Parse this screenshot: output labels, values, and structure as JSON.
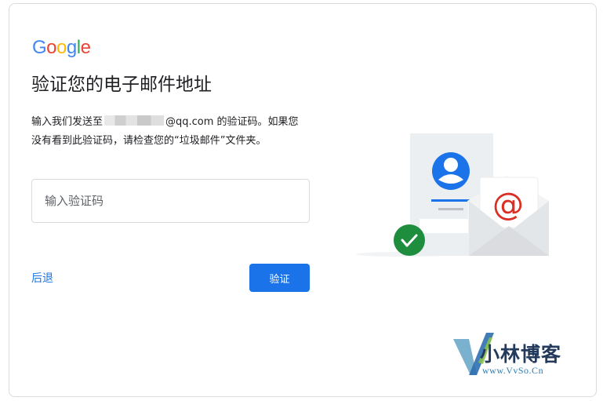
{
  "logo": {
    "letters": [
      {
        "char": "G",
        "color": "#4285F4"
      },
      {
        "char": "o",
        "color": "#EA4335"
      },
      {
        "char": "o",
        "color": "#FBBC05"
      },
      {
        "char": "g",
        "color": "#4285F4"
      },
      {
        "char": "l",
        "color": "#34A853"
      },
      {
        "char": "e",
        "color": "#EA4335"
      }
    ]
  },
  "page": {
    "title": "验证您的电子邮件地址",
    "description_prefix": "输入我们发送至",
    "email_visible": "@qq.com",
    "description_suffix": " 的验证码。如果您没有看到此验证码，请检查您的“垃圾邮件”文件夹。"
  },
  "form": {
    "code_placeholder": "输入验证码",
    "code_value": ""
  },
  "actions": {
    "back_label": "后退",
    "verify_label": "验证"
  },
  "illustration": {
    "icons": [
      "contact-card-icon",
      "envelope-icon",
      "at-sign-icon",
      "checkmark-icon"
    ],
    "at_symbol": "@",
    "colors": {
      "blue": "#1a73e8",
      "red": "#d93025",
      "green": "#1e8e3e",
      "grey": "#e8eaed"
    }
  },
  "watermark": {
    "title": "小林博客",
    "url": "www.VvSo.Cn"
  },
  "colors": {
    "accent": "#1a73e8",
    "text": "#202124",
    "border": "#dadce0"
  }
}
